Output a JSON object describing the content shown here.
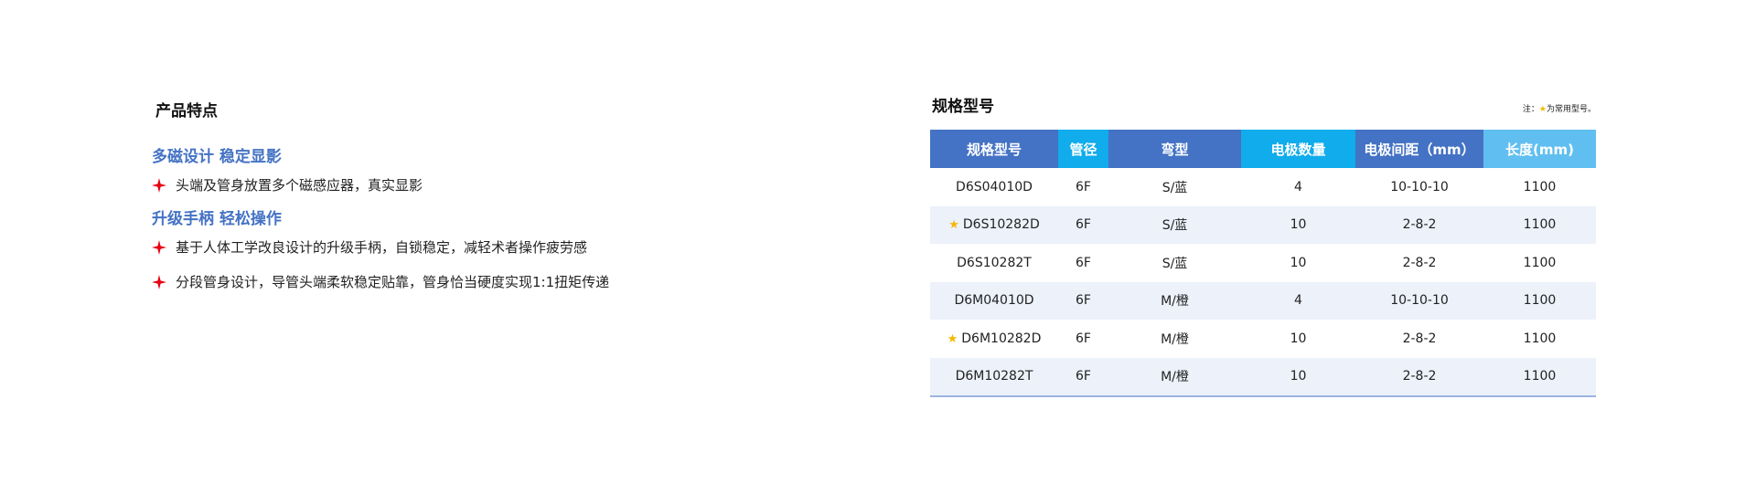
{
  "features": {
    "title": "产品特点",
    "groups": [
      {
        "heading": "多磁设计 稳定显影",
        "bullets": [
          "头端及管身放置多个磁感应器，真实显影"
        ]
      },
      {
        "heading": "升级手柄 轻松操作",
        "bullets": [
          "基于人体工学改良设计的升级手柄，自锁稳定，减轻术者操作疲劳感",
          "分段管身设计，导管头端柔软稳定贴靠，管身恰当硬度实现1:1扭矩传递"
        ]
      }
    ],
    "bullet_icon": "red-four-point-star-icon",
    "bullet_color": "#e60012",
    "heading_color": "#4472c4"
  },
  "spec": {
    "title": "规格型号",
    "note_prefix": "注：",
    "note_star": "★",
    "note_suffix": "为常用型号。",
    "star_color": "#f5b800",
    "columns": [
      "规格型号",
      "管径",
      "弯型",
      "电极数量",
      "电极间距（mm）",
      "长度(mm)"
    ],
    "header_colors": [
      "#4472c4",
      "#10acec",
      "#4472c4",
      "#10acec",
      "#4472c4",
      "#60bff0"
    ],
    "rows": [
      {
        "starred": false,
        "model": "D6S04010D",
        "diameter": "6F",
        "curve": "S/蓝",
        "electrodes": "4",
        "spacing": "10-10-10",
        "length": "1100"
      },
      {
        "starred": true,
        "model": "D6S10282D",
        "diameter": "6F",
        "curve": "S/蓝",
        "electrodes": "10",
        "spacing": "2-8-2",
        "length": "1100"
      },
      {
        "starred": false,
        "model": "D6S10282T",
        "diameter": "6F",
        "curve": "S/蓝",
        "electrodes": "10",
        "spacing": "2-8-2",
        "length": "1100"
      },
      {
        "starred": false,
        "model": "D6M04010D",
        "diameter": "6F",
        "curve": "M/橙",
        "electrodes": "4",
        "spacing": "10-10-10",
        "length": "1100"
      },
      {
        "starred": true,
        "model": "D6M10282D",
        "diameter": "6F",
        "curve": "M/橙",
        "electrodes": "10",
        "spacing": "2-8-2",
        "length": "1100"
      },
      {
        "starred": false,
        "model": "D6M10282T",
        "diameter": "6F",
        "curve": "M/橙",
        "electrodes": "10",
        "spacing": "2-8-2",
        "length": "1100"
      }
    ]
  }
}
